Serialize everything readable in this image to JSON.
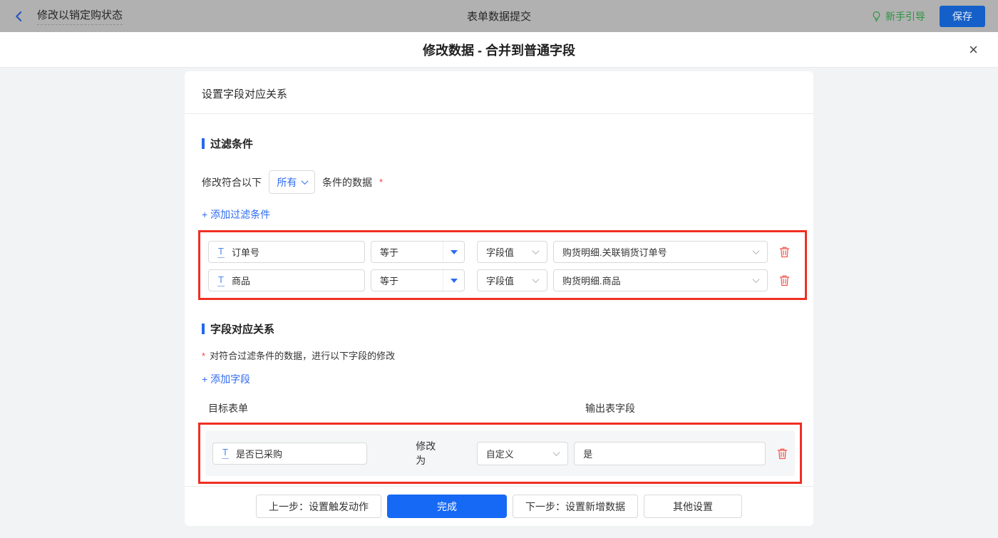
{
  "topbar": {
    "back_title": "修改以销定购状态",
    "center_title": "表单数据提交",
    "guide_label": "新手引导",
    "save_label": "保存"
  },
  "dialog": {
    "title": "修改数据 - 合并到普通字段",
    "close_glyph": "×"
  },
  "icons": {
    "text_field_glyph": "T"
  },
  "card": {
    "header": "设置字段对应关系",
    "filter_section": {
      "title": "过滤条件",
      "cond_prefix": "修改符合以下",
      "match_value": "所有",
      "cond_suffix": "条件的数据",
      "required_mark": "*",
      "add_link": "+ 添加过滤条件",
      "rows": [
        {
          "field": "订单号",
          "operator": "等于",
          "value_type": "字段值",
          "value": "购货明细.关联销货订单号"
        },
        {
          "field": "商品",
          "operator": "等于",
          "value_type": "字段值",
          "value": "购货明细.商品"
        }
      ]
    },
    "mapping_section": {
      "title": "字段对应关系",
      "required_mark": "*",
      "note": "对符合过滤条件的数据，进行以下字段的修改",
      "add_link": "+ 添加字段",
      "col_target": "目标表单",
      "col_output": "输出表字段",
      "rows": [
        {
          "field": "是否已采购",
          "action": "修改为",
          "mode": "自定义",
          "value": "是"
        }
      ]
    },
    "footer": {
      "prev_label": "上一步：设置触发动作",
      "done_label": "完成",
      "next_label": "下一步：设置新增数据",
      "other_label": "其他设置"
    }
  },
  "colors": {
    "accent_blue": "#2e6bf0",
    "highlight_red": "#ee2f23",
    "trash_red": "#f2544b",
    "guide_green": "#2a9440",
    "save_blue": "#1560c8",
    "done_blue": "#1669f5",
    "topbar_gray": "#b1b1b1"
  }
}
